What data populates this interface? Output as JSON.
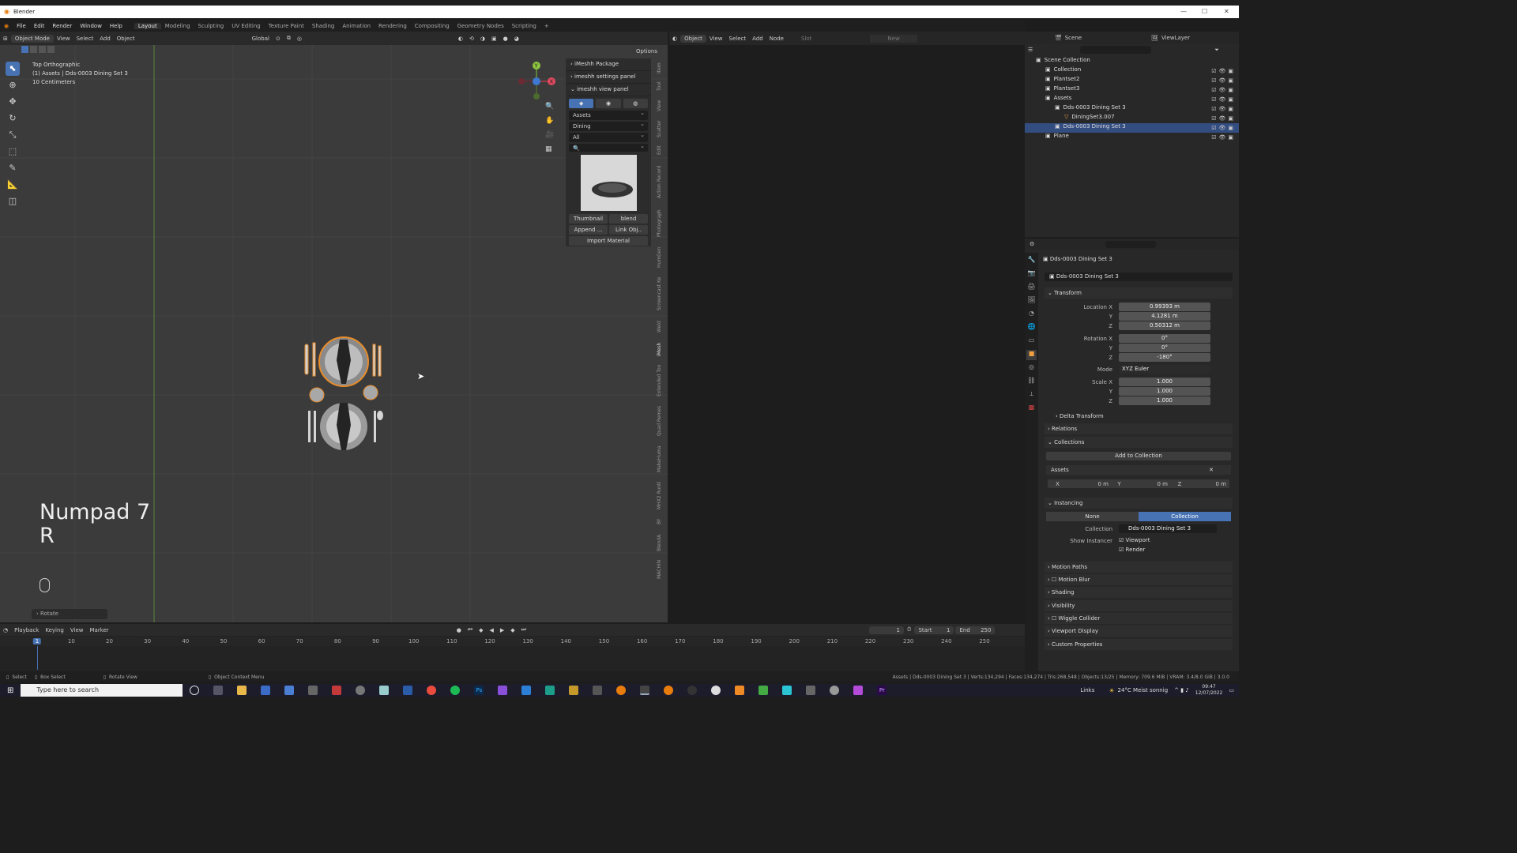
{
  "titlebar": {
    "app": "Blender"
  },
  "menu": [
    "File",
    "Edit",
    "Render",
    "Window",
    "Help"
  ],
  "workspaces": [
    "Layout",
    "Modeling",
    "Sculpting",
    "UV Editing",
    "Texture Paint",
    "Shading",
    "Animation",
    "Rendering",
    "Compositing",
    "Geometry Nodes",
    "Scripting"
  ],
  "viewport": {
    "mode": "Object Mode",
    "menus": [
      "View",
      "Select",
      "Add",
      "Object"
    ],
    "orientation": "Global",
    "options": "Options",
    "overlay_lines": [
      "Top Orthographic",
      "(1) Assets | Dds-0003 Dining Set 3",
      "10 Centimeters"
    ],
    "keyhint_line1": "Numpad 7",
    "keyhint_line2": "R",
    "last_op": "Rotate"
  },
  "addon_panel": {
    "headers": [
      "iMeshh Package",
      "imeshh settings panel",
      "imeshh view panel"
    ],
    "dropdowns": [
      "Assets",
      "Dining",
      "All"
    ],
    "btn_thumbnail": "Thumbnail",
    "btn_blend": "blend",
    "btn_append": "Append ...",
    "btn_link": "Link Obj..",
    "btn_import": "Import Material"
  },
  "side_tabs": [
    "Item",
    "Tool",
    "View",
    "Scatter",
    "Edit",
    "Action Record",
    "Photograph",
    "HumGen",
    "Screencast Ke",
    "Weld",
    "iMesh",
    "Extended Too",
    "Quad Remes",
    "MakeHuma",
    "MHX2 Runti",
    "BY",
    "BlendA",
    "MACHIN"
  ],
  "node_editor": {
    "mode": "Object",
    "menus": [
      "View",
      "Select",
      "Add",
      "Node"
    ],
    "slot": "Slot",
    "new": "New"
  },
  "outliner": {
    "scene": "Scene",
    "view_layer": "ViewLayer",
    "items": [
      {
        "label": "Scene Collection",
        "indent": 0
      },
      {
        "label": "Collection",
        "indent": 1
      },
      {
        "label": "Plantset2",
        "indent": 1
      },
      {
        "label": "Plantset3",
        "indent": 1
      },
      {
        "label": "Assets",
        "indent": 1
      },
      {
        "label": "Dds-0003 Dining Set 3",
        "indent": 2
      },
      {
        "label": "DiningSet3.007",
        "indent": 3
      },
      {
        "label": "Dds-0003 Dining Set 3",
        "indent": 2,
        "selected": true
      },
      {
        "label": "Plane",
        "indent": 1
      }
    ]
  },
  "properties": {
    "object_name": "Dds-0003 Dining Set 3",
    "object_field": "Dds-0003 Dining Set 3",
    "transform": "Transform",
    "loc_label": "Location X",
    "loc": [
      "0.99393 m",
      "4.1281 m",
      "0.50312 m"
    ],
    "rot_label": "Rotation X",
    "rot": [
      "0°",
      "0°",
      "-180°"
    ],
    "mode_label": "Mode",
    "mode": "XYZ Euler",
    "scale_label": "Scale X",
    "scale": [
      "1.000",
      "1.000",
      "1.000"
    ],
    "axis_y": "Y",
    "axis_z": "Z",
    "delta": "Delta Transform",
    "relations": "Relations",
    "collections": "Collections",
    "add_to_collection": "Add to Collection",
    "collection_name": "Assets",
    "offset": [
      "X",
      "0 m",
      "Y",
      "0 m",
      "Z",
      "0 m"
    ],
    "instancing": "Instancing",
    "inst_none": "None",
    "inst_collection": "Collection",
    "collection_label": "Collection",
    "collection_value": "Dds-0003 Dining Set 3",
    "show_instancer": "Show Instancer",
    "viewport_chk": "Viewport",
    "render_chk": "Render",
    "sections": [
      "Motion Paths",
      "Motion Blur",
      "Shading",
      "Visibility",
      "Wiggle Collider",
      "Viewport Display",
      "Custom Properties"
    ]
  },
  "timeline": {
    "menus": [
      "Playback",
      "Keying",
      "View",
      "Marker"
    ],
    "current": "1",
    "start_label": "Start",
    "start": "1",
    "end_label": "End",
    "end": "250",
    "ticks": [
      "1",
      "10",
      "20",
      "30",
      "40",
      "50",
      "60",
      "70",
      "80",
      "90",
      "100",
      "110",
      "120",
      "130",
      "140",
      "150",
      "160",
      "170",
      "180",
      "190",
      "200",
      "210",
      "220",
      "230",
      "240",
      "250"
    ]
  },
  "statusbar": {
    "select": "Select",
    "box_select": "Box Select",
    "rotate_view": "Rotate View",
    "context_menu": "Object Context Menu",
    "stats": "Assets | Dds-0003 Dining Set 3 | Verts:134,294 | Faces:134,274 | Tris:268,548 | Objects:13/25 | Memory: 709.6 MiB | VRAM: 3.4/8.0 GiB | 3.0.0"
  },
  "taskbar": {
    "search": "Type here to search",
    "links": "Links",
    "weather": "24°C  Meist sonnig",
    "time": "09:47",
    "date": "12/07/2022"
  }
}
